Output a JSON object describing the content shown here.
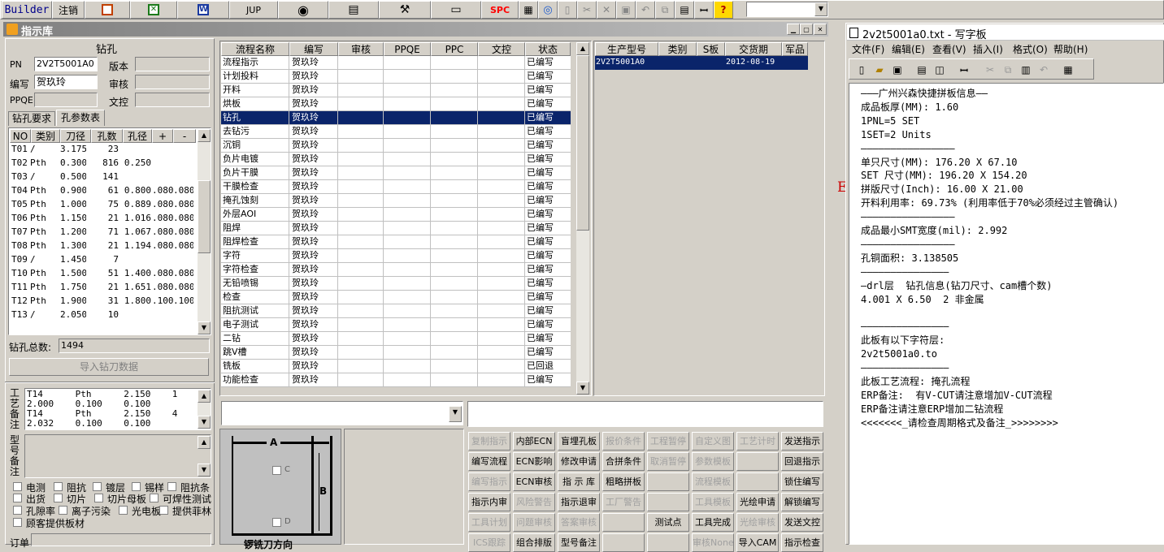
{
  "toolbar": {
    "builder": "Builder",
    "logout": "注销",
    "jup": "JUP",
    "spc": "SPC"
  },
  "app": {
    "title": "指示库"
  },
  "drill_panel": {
    "title": "钻孔",
    "pn_label": "PN",
    "pn_value": "2V2T5001A0",
    "version_label": "版本",
    "writer_label": "编写",
    "writer_value": "贺玖玲",
    "review_label": "审核",
    "ppqe_label": "PPQE",
    "doc_control_label": "文控",
    "tab_requirements": "钻孔要求",
    "tab_params": "孔参数表",
    "cols": [
      "NO",
      "类别",
      "刀径",
      "孔数",
      "孔径",
      "+",
      "-"
    ],
    "rows": [
      [
        "T01",
        "/",
        "3.175",
        "23",
        "",
        "",
        ""
      ],
      [
        "T02",
        "Pth",
        "0.300",
        "816",
        "0.250",
        "",
        ""
      ],
      [
        "T03",
        "/",
        "0.500",
        "141",
        "",
        "",
        ""
      ],
      [
        "T04",
        "Pth",
        "0.900",
        "61",
        "0.800",
        ".080",
        ".080"
      ],
      [
        "T05",
        "Pth",
        "1.000",
        "75",
        "0.889",
        ".080",
        ".080"
      ],
      [
        "T06",
        "Pth",
        "1.150",
        "21",
        "1.016",
        ".080",
        ".080"
      ],
      [
        "T07",
        "Pth",
        "1.200",
        "71",
        "1.067",
        ".080",
        ".080"
      ],
      [
        "T08",
        "Pth",
        "1.300",
        "21",
        "1.194",
        ".080",
        ".080"
      ],
      [
        "T09",
        "/",
        "1.450",
        "7",
        "",
        "",
        ""
      ],
      [
        "T10",
        "Pth",
        "1.500",
        "51",
        "1.400",
        ".080",
        ".080"
      ],
      [
        "T11",
        "Pth",
        "1.750",
        "21",
        "1.651",
        ".080",
        ".080"
      ],
      [
        "T12",
        "Pth",
        "1.900",
        "31",
        "1.800",
        ".100",
        ".100"
      ],
      [
        "T13",
        "/",
        "2.050",
        "10",
        "",
        "",
        ""
      ]
    ],
    "total_label": "钻孔总数:",
    "total_value": "1494",
    "import_button": "导入钻刀数据",
    "process_notes_label": "工艺备注",
    "process_notes": [
      "T14      Pth      2.150    1",
      "2.000    0.100    0.100",
      "T14      Pth      2.150    4",
      "2.032    0.100    0.100"
    ],
    "model_notes_label": "型号备注",
    "checks": [
      "电测",
      "阻抗",
      "镀层",
      "锡样",
      "阻抗条",
      "出货",
      "切片",
      "切片母板",
      "可焊性测试",
      "孔隙率",
      "离子污染",
      "光电板",
      "提供菲林",
      "顾客提供板材"
    ],
    "order_label": "订单"
  },
  "flow_table": {
    "cols": [
      "流程名称",
      "编写",
      "审核",
      "PPQE",
      "PPC",
      "文控",
      "状态"
    ],
    "rows": [
      [
        "流程指示",
        "贺玖玲",
        "已编写"
      ],
      [
        "计划投料",
        "贺玖玲",
        "已编写"
      ],
      [
        "开料",
        "贺玖玲",
        "已编写"
      ],
      [
        "烘板",
        "贺玖玲",
        "已编写"
      ],
      [
        "钻孔",
        "贺玖玲",
        "已编写"
      ],
      [
        "去钻污",
        "贺玖玲",
        "已编写"
      ],
      [
        "沉铜",
        "贺玖玲",
        "已编写"
      ],
      [
        "负片电镀",
        "贺玖玲",
        "已编写"
      ],
      [
        "负片干膜",
        "贺玖玲",
        "已编写"
      ],
      [
        "干膜检查",
        "贺玖玲",
        "已编写"
      ],
      [
        "掩孔蚀刻",
        "贺玖玲",
        "已编写"
      ],
      [
        "外层AOI",
        "贺玖玲",
        "已编写"
      ],
      [
        "阻焊",
        "贺玖玲",
        "已编写"
      ],
      [
        "阻焊检查",
        "贺玖玲",
        "已编写"
      ],
      [
        "字符",
        "贺玖玲",
        "已编写"
      ],
      [
        "字符检查",
        "贺玖玲",
        "已编写"
      ],
      [
        "无铅喷锡",
        "贺玖玲",
        "已编写"
      ],
      [
        "检查",
        "贺玖玲",
        "已编写"
      ],
      [
        "阻抗测试",
        "贺玖玲",
        "已编写"
      ],
      [
        "电子测试",
        "贺玖玲",
        "已编写"
      ],
      [
        "二钻",
        "贺玖玲",
        "已编写"
      ],
      [
        "跳V槽",
        "贺玖玲",
        "已编写"
      ],
      [
        "铣板",
        "贺玖玲",
        "已回退"
      ],
      [
        "功能检查",
        "贺玖玲",
        "已编写"
      ]
    ]
  },
  "prod_table": {
    "cols": [
      "生产型号",
      "类别",
      "S板",
      "交货期",
      "军品"
    ],
    "rows": [
      [
        "2V2T5001A0",
        "",
        "",
        "2012-08-19",
        ""
      ]
    ]
  },
  "diagram": {
    "label_a": "A",
    "label_b": "B",
    "label_c": "C",
    "label_d": "D",
    "caption": "锣铣刀方向"
  },
  "buttons": [
    [
      "复制指示",
      "内部ECN",
      "盲埋孔板",
      "报价条件",
      "工程暂停",
      "自定义图",
      "工艺计时",
      "发送指示"
    ],
    [
      "编写流程",
      "ECN影响",
      "修改申请",
      "合拼条件",
      "取消暂停",
      "参数模板",
      "",
      "回退指示"
    ],
    [
      "编写指示",
      "ECN审核",
      "指 示 库",
      "粗略拼板",
      "",
      "流程模板",
      "",
      "锁住编写"
    ],
    [
      "指示内审",
      "风险警告",
      "指示退审",
      "工厂警告",
      "",
      "工具模板",
      "光绘申请",
      "解锁编写"
    ],
    [
      "工具计划",
      "问题审核",
      "答案审核",
      "",
      "测试点",
      "工具完成",
      "光绘审核",
      "发送文控"
    ],
    [
      "ICS跟踪",
      "组合排版",
      "型号备注",
      "",
      "",
      "审核None",
      "导入CAM",
      "指示检查"
    ]
  ],
  "buttons_disabled": [
    [
      1,
      0,
      0,
      1,
      1,
      1,
      1,
      0
    ],
    [
      0,
      0,
      0,
      0,
      1,
      1,
      0,
      0
    ],
    [
      1,
      0,
      0,
      0,
      0,
      1,
      0,
      0
    ],
    [
      0,
      1,
      0,
      1,
      0,
      1,
      0,
      0
    ],
    [
      1,
      1,
      1,
      0,
      0,
      0,
      1,
      0
    ],
    [
      1,
      0,
      0,
      0,
      0,
      1,
      0,
      0
    ]
  ],
  "notepad": {
    "title": "2v2t5001a0.txt - 写字板",
    "menu": [
      "文件(F)",
      "编辑(E)",
      "查看(V)",
      "插入(I)",
      "格式(O)",
      "帮助(H)"
    ],
    "lines": [
      "———广州兴森快捷拼板信息——",
      "成品板厚(MM): 1.60",
      "1PNL=5 SET",
      "1SET=2 Units",
      "————————————————",
      "单只尺寸(MM): 176.20 X 67.10",
      "SET 尺寸(MM): 196.20 X 154.20",
      "拼版尺寸(Inch): 16.00 X 21.00",
      "开料利用率: 69.73% (利用率低于70%必须经过主管确认)",
      "————————————————",
      "成品最小SMT宽度(mil): 2.992",
      "————————————————",
      "孔铜面积: 3.138505",
      "———————————————",
      "—drl层  钻孔信息(钻刀尺寸、cam槽个数)",
      "4.001 X 6.50  2 非金属",
      "",
      "———————————————",
      "此板有以下字符层:",
      "2v2t5001a0.to",
      "———————————————",
      "此板工艺流程: 掩孔流程",
      "ERP备注:  有V-CUT请注意增加V-CUT流程",
      "ERP备注请注意ERP增加二钻流程",
      "<<<<<<<_请检查周期格式及备注_>>>>>>>>"
    ],
    "behind_letter": "E"
  },
  "colors": {
    "face": "#d4d0c8",
    "select": "#0a246a",
    "titlebar": "#808080",
    "active_titlebar": "#0a246a",
    "spc_red": "#ff0000"
  }
}
